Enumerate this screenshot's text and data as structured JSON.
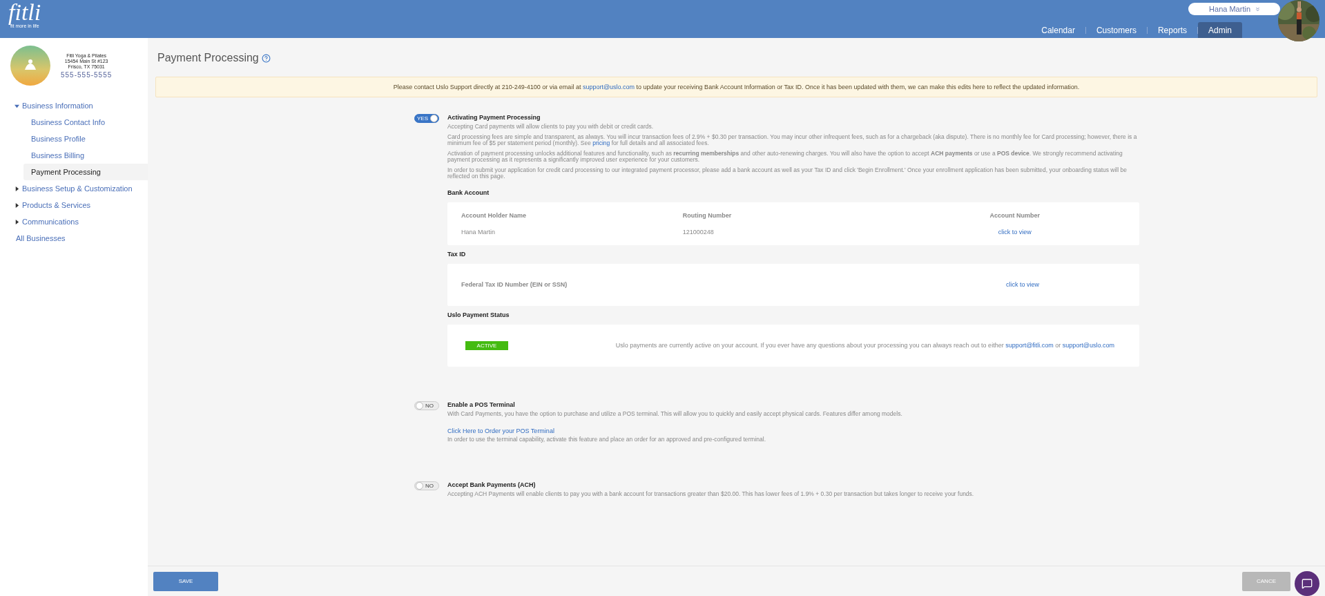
{
  "header": {
    "logo": {
      "name": "fitli",
      "tagline": "fit more in life"
    },
    "user": {
      "name": "Hana Martin"
    },
    "nav": [
      {
        "label": "Calendar",
        "selected": false
      },
      {
        "label": "Customers",
        "selected": false
      },
      {
        "label": "Reports",
        "selected": false
      },
      {
        "label": "Admin",
        "selected": true
      }
    ]
  },
  "sidebar": {
    "business": {
      "name": "Fitli Yoga & Pilates",
      "address_line1": "15454 Main St #123",
      "address_line2": "Frisco, TX 75031",
      "phone": "555-555-5555"
    },
    "nav": [
      {
        "label": "Business Information",
        "kind": "group",
        "expanded": true,
        "children": [
          {
            "label": "Business Contact Info",
            "selected": false
          },
          {
            "label": "Business Profile",
            "selected": false
          },
          {
            "label": "Business Billing",
            "selected": false
          },
          {
            "label": "Payment Processing",
            "selected": true
          }
        ]
      },
      {
        "label": "Business Setup & Customization",
        "kind": "group",
        "expanded": false
      },
      {
        "label": "Products & Services",
        "kind": "group",
        "expanded": false
      },
      {
        "label": "Communications",
        "kind": "group",
        "expanded": false
      },
      {
        "label": "All Businesses",
        "kind": "link"
      }
    ]
  },
  "page": {
    "title": "Payment Processing",
    "notice": [
      {
        "kind": "plain",
        "text": "Please contact Uslo Support directly at 210-249-4100 or via email at "
      },
      {
        "kind": "link",
        "text": "support@uslo.com"
      },
      {
        "kind": "plain",
        "text": " to update your receiving Bank Account Information or Tax ID. Once it has been updated with them, we can make this edits here to reflect the updated information."
      }
    ],
    "sections": [
      {
        "toggle": {
          "on": true,
          "label": "YES"
        },
        "title": "Activating Payment Processing",
        "paragraphs": [
          [
            {
              "kind": "plain",
              "text": "Accepting Card payments will allow clients to pay you with debit or credit cards."
            }
          ],
          [
            {
              "kind": "plain",
              "text": "Card processing fees are simple and transparent, as always. You will incur transaction fees of 2.9% + $0.30 per transaction. You may incur other infrequent fees, such as for a chargeback (aka dispute). There is no monthly fee for Card processing; however, there is a minimum fee of $5 per statement period (monthly). See "
            },
            {
              "kind": "link",
              "text": "pricing"
            },
            {
              "kind": "plain",
              "text": " for full details and all associated fees."
            }
          ],
          [
            {
              "kind": "plain",
              "text": "Activation of payment processing unlocks additional features and functionality, such as "
            },
            {
              "kind": "bold",
              "text": "recurring memberships"
            },
            {
              "kind": "plain",
              "text": " and other auto-renewing charges. You will also have the option to accept "
            },
            {
              "kind": "bold",
              "text": "ACH payments"
            },
            {
              "kind": "plain",
              "text": " or use a "
            },
            {
              "kind": "bold",
              "text": "POS device"
            },
            {
              "kind": "plain",
              "text": ". We strongly recommend activating payment processing as it represents a significantly improved user experience for your customers."
            }
          ],
          [
            {
              "kind": "plain",
              "text": "In order to submit your application for credit card processing to our integrated payment processor, please add a bank account as well as your Tax ID and click 'Begin Enrollment.' Once your enrollment application has been submitted, your onboarding status will be reflected on this page."
            }
          ]
        ],
        "blocks": [
          {
            "kind": "table",
            "heading": "Bank Account",
            "columns": [
              "Account Holder Name",
              "Routing Number",
              "Account Number"
            ],
            "row": [
              {
                "kind": "plain",
                "text": "Hana Martin"
              },
              {
                "kind": "plain",
                "text": "121000248"
              },
              {
                "kind": "link",
                "text": "click to view"
              }
            ]
          },
          {
            "kind": "field",
            "heading": "Tax ID",
            "label": "Federal Tax ID Number (EIN or SSN)",
            "link": "click to view"
          },
          {
            "kind": "status",
            "heading": "Uslo Payment Status",
            "badge": "ACTIVE",
            "message": [
              {
                "kind": "plain",
                "text": "Uslo payments are currently active on your account. If you ever have any questions about your processing you can always reach out to either "
              },
              {
                "kind": "link",
                "text": "support@fitli.com"
              },
              {
                "kind": "plain",
                "text": " or "
              },
              {
                "kind": "link",
                "text": "support@uslo.com"
              }
            ]
          }
        ]
      },
      {
        "toggle": {
          "on": false,
          "label": "NO"
        },
        "title": "Enable a POS Terminal",
        "paragraphs": [
          [
            {
              "kind": "plain",
              "text": "With Card Payments, you have the option to purchase and utilize a POS terminal. This will allow you to quickly and easily accept physical cards. Features differ among models."
            }
          ]
        ],
        "link": "Click Here to Order your POS Terminal",
        "note": "In order to use the terminal capability, activate this feature and place an order for an approved and pre-configured terminal."
      },
      {
        "toggle": {
          "on": false,
          "label": "NO"
        },
        "title": "Accept Bank Payments (ACH)",
        "paragraphs": [
          [
            {
              "kind": "plain",
              "text": "Accepting ACH Payments will enable clients to pay you with a bank account for transactions greater than $20.00. This has lower fees of 1.9% + 0.30 per transaction but takes longer to receive your funds."
            }
          ]
        ]
      }
    ]
  },
  "footer": {
    "save": "SAVE",
    "cancel": "CANCE"
  }
}
